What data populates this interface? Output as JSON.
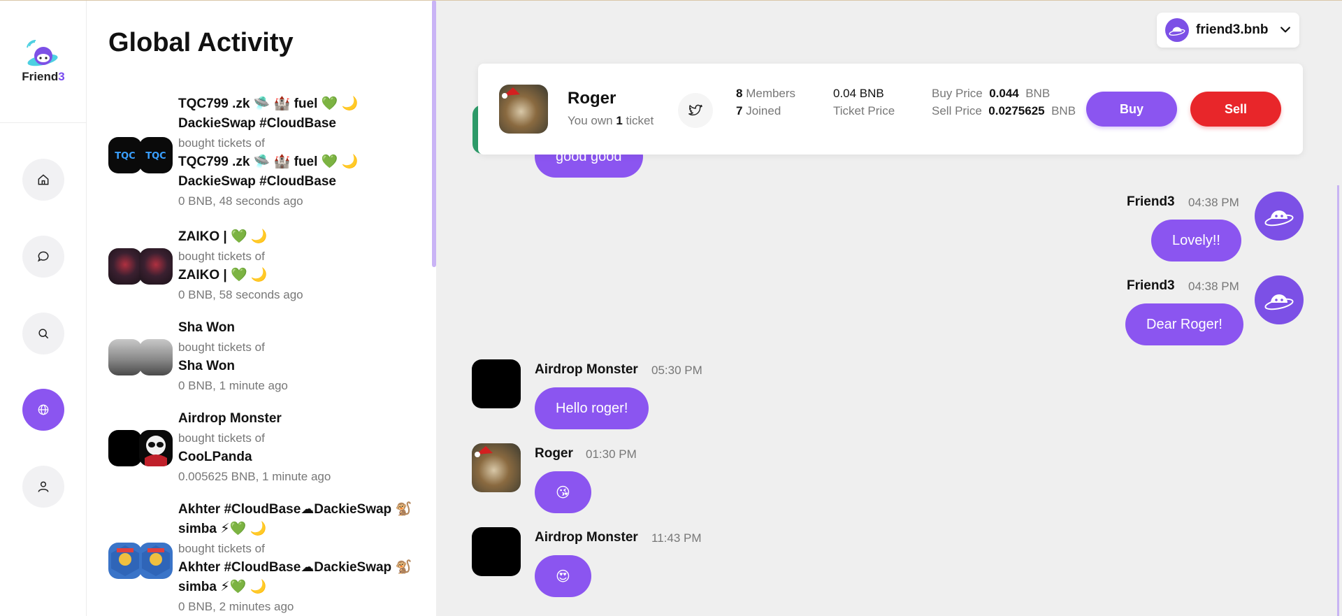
{
  "brand": {
    "logo_text": "Friend",
    "logo_suffix": "3"
  },
  "nav": [
    {
      "icon": "home-icon",
      "active": false
    },
    {
      "icon": "chat-icon",
      "active": false
    },
    {
      "icon": "search-icon",
      "active": false
    },
    {
      "icon": "globe-icon",
      "active": true
    },
    {
      "icon": "user-icon",
      "active": false
    }
  ],
  "activity": {
    "title": "Global Activity",
    "items": [
      {
        "buyer": "TQC799 .zk 🛸 🏰 fuel 💚 🌙 DackieSwap #CloudBase",
        "action": "bought tickets of",
        "subject": "TQC799 .zk 🛸 🏰 fuel 💚 🌙 DackieSwap #CloudBase",
        "meta": "0 BNB, 48 seconds ago"
      },
      {
        "buyer": "ZAIKO | 💚 🌙",
        "action": "bought tickets of",
        "subject": "ZAIKO | 💚 🌙",
        "meta": "0 BNB, 58 seconds ago"
      },
      {
        "buyer": "Sha Won",
        "action": "bought tickets of",
        "subject": "Sha Won",
        "meta": "0 BNB, 1 minute ago"
      },
      {
        "buyer": "Airdrop Monster",
        "action": "bought tickets of",
        "subject": "CooLPanda",
        "meta": "0.005625 BNB, 1 minute ago"
      },
      {
        "buyer": "Akhter #CloudBase☁DackieSwap 🐒simba ⚡💚 🌙",
        "action": "bought tickets of",
        "subject": "Akhter #CloudBase☁DackieSwap 🐒simba ⚡💚 🌙",
        "meta": "0 BNB, 2 minutes ago"
      }
    ]
  },
  "account": {
    "name": "friend3.bnb"
  },
  "room": {
    "name": "Roger",
    "own_prefix": "You own",
    "own_count": "1",
    "own_suffix": "ticket",
    "members_count": "8",
    "members_label": "Members",
    "joined_count": "7",
    "joined_label": "Joined",
    "ticket_price_value": "0.04 BNB",
    "ticket_price_label": "Ticket Price",
    "buy_price_label": "Buy Price",
    "buy_price_value": "0.044",
    "sell_price_label": "Sell Price",
    "sell_price_value": "0.0275625",
    "currency": "BNB",
    "buy_label": "Buy",
    "sell_label": "Sell"
  },
  "messages": [
    {
      "text": "good good",
      "side": "left"
    },
    {
      "name": "Friend3",
      "time": "04:38 PM",
      "text": "Lovely!!",
      "side": "right"
    },
    {
      "name": "Friend3",
      "time": "04:38 PM",
      "text": "Dear Roger!",
      "side": "right"
    },
    {
      "name": "Airdrop Monster",
      "time": "05:30 PM",
      "text": "Hello roger!",
      "side": "left"
    },
    {
      "name": "Roger",
      "time": "01:30 PM",
      "text": "😘",
      "side": "left"
    },
    {
      "name": "Airdrop Monster",
      "time": "11:43 PM",
      "text": "😍",
      "side": "left"
    }
  ],
  "colors": {
    "accent": "#8b55f0",
    "sell": "#e8262a",
    "chat_bg": "#efefef"
  }
}
